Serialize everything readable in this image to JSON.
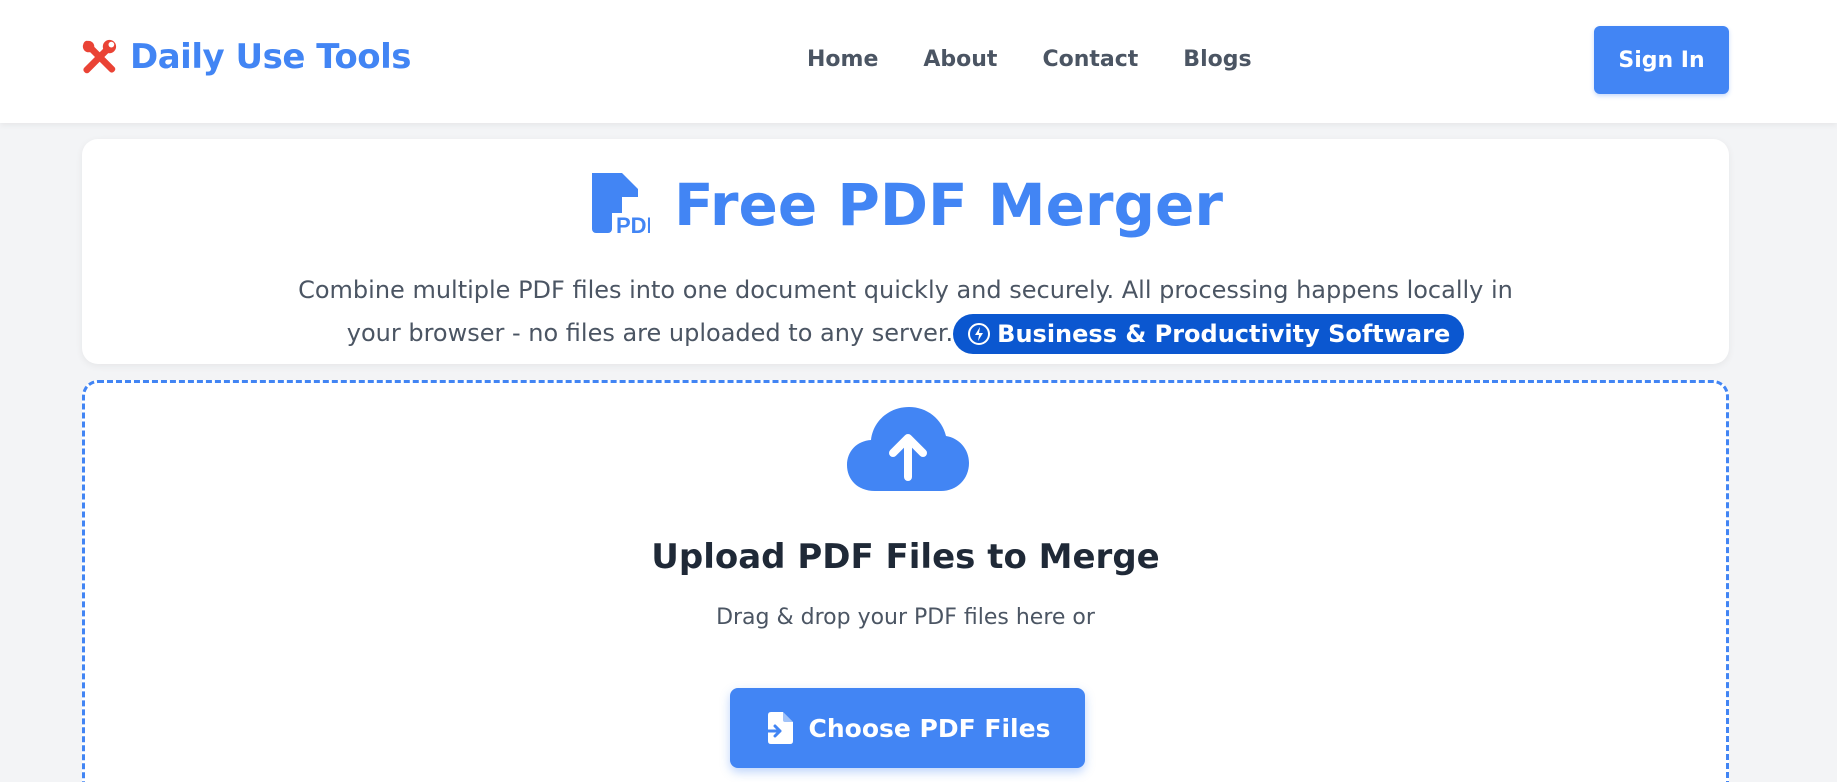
{
  "header": {
    "logo_icon": "tools-icon",
    "logo_text": "Daily Use Tools",
    "nav": [
      "Home",
      "About",
      "Contact",
      "Blogs"
    ],
    "signin_label": "Sign In"
  },
  "hero": {
    "icon": "pdf-file-icon",
    "title": "Free PDF Merger",
    "description": "Combine multiple PDF files into one document quickly and securely. All processing happens locally in your browser - no files are uploaded to any server.",
    "badge_icon": "bolt-circle-icon",
    "badge_label": "Business & Productivity Software"
  },
  "upload": {
    "icon": "cloud-upload-icon",
    "title": "Upload PDF Files to Merge",
    "subtitle": "Drag & drop your PDF files here or",
    "button_icon": "file-import-icon",
    "button_label": "Choose PDF Files"
  },
  "colors": {
    "accent": "#4285f4",
    "badge": "#0b57d0",
    "logo_icon": "#ea4335"
  }
}
